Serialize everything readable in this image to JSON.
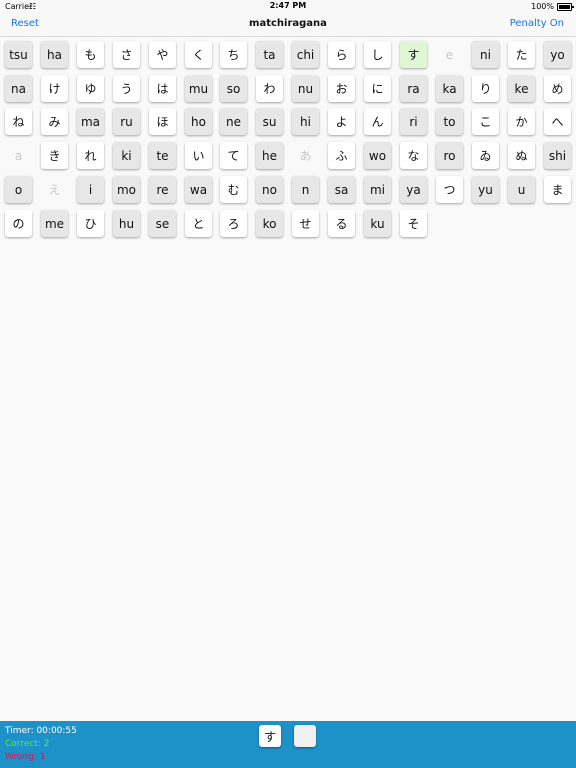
{
  "status_bar": {
    "carrier": "Carrier",
    "wifi": "wifi-icon",
    "time": "2:47 PM",
    "battery": "100%"
  },
  "nav": {
    "left": "Reset",
    "title": "matchiragana",
    "right": "Penalty On"
  },
  "grid": [
    [
      {
        "t": "tsu",
        "k": "romaji"
      },
      {
        "t": "ha",
        "k": "romaji"
      },
      {
        "t": "も",
        "k": "kana"
      },
      {
        "t": "さ",
        "k": "kana"
      },
      {
        "t": "や",
        "k": "kana"
      },
      {
        "t": "く",
        "k": "kana"
      },
      {
        "t": "ち",
        "k": "kana"
      },
      {
        "t": "ta",
        "k": "romaji"
      },
      {
        "t": "chi",
        "k": "romaji"
      },
      {
        "t": "ら",
        "k": "kana"
      },
      {
        "t": "し",
        "k": "kana"
      },
      {
        "t": "す",
        "k": "selected"
      },
      {
        "t": "e",
        "k": "matched"
      },
      {
        "t": "ni",
        "k": "romaji"
      },
      {
        "t": "た",
        "k": "kana"
      },
      {
        "t": "yo",
        "k": "romaji"
      }
    ],
    [
      {
        "t": "na",
        "k": "romaji"
      },
      {
        "t": "け",
        "k": "kana"
      },
      {
        "t": "ゆ",
        "k": "kana"
      },
      {
        "t": "う",
        "k": "kana"
      },
      {
        "t": "は",
        "k": "kana"
      },
      {
        "t": "mu",
        "k": "romaji"
      },
      {
        "t": "so",
        "k": "romaji"
      },
      {
        "t": "わ",
        "k": "kana"
      },
      {
        "t": "nu",
        "k": "romaji"
      },
      {
        "t": "お",
        "k": "kana"
      },
      {
        "t": "に",
        "k": "kana"
      },
      {
        "t": "ra",
        "k": "romaji"
      },
      {
        "t": "ka",
        "k": "romaji"
      },
      {
        "t": "り",
        "k": "kana"
      },
      {
        "t": "ke",
        "k": "romaji"
      },
      {
        "t": "め",
        "k": "kana"
      }
    ],
    [
      {
        "t": "ね",
        "k": "kana"
      },
      {
        "t": "み",
        "k": "kana"
      },
      {
        "t": "ma",
        "k": "romaji"
      },
      {
        "t": "ru",
        "k": "romaji"
      },
      {
        "t": "ほ",
        "k": "kana"
      },
      {
        "t": "ho",
        "k": "romaji"
      },
      {
        "t": "ne",
        "k": "romaji"
      },
      {
        "t": "su",
        "k": "romaji"
      },
      {
        "t": "hi",
        "k": "romaji"
      },
      {
        "t": "よ",
        "k": "kana"
      },
      {
        "t": "ん",
        "k": "kana"
      },
      {
        "t": "ri",
        "k": "romaji"
      },
      {
        "t": "to",
        "k": "romaji"
      },
      {
        "t": "こ",
        "k": "kana"
      },
      {
        "t": "か",
        "k": "kana"
      },
      {
        "t": "へ",
        "k": "kana"
      }
    ],
    [
      {
        "t": "a",
        "k": "matched"
      },
      {
        "t": "き",
        "k": "kana"
      },
      {
        "t": "れ",
        "k": "kana"
      },
      {
        "t": "ki",
        "k": "romaji"
      },
      {
        "t": "te",
        "k": "romaji"
      },
      {
        "t": "い",
        "k": "kana"
      },
      {
        "t": "て",
        "k": "kana"
      },
      {
        "t": "he",
        "k": "romaji"
      },
      {
        "t": "あ",
        "k": "matched"
      },
      {
        "t": "ふ",
        "k": "kana"
      },
      {
        "t": "wo",
        "k": "romaji"
      },
      {
        "t": "な",
        "k": "kana"
      },
      {
        "t": "ro",
        "k": "romaji"
      },
      {
        "t": "ゐ",
        "k": "kana"
      },
      {
        "t": "ぬ",
        "k": "kana"
      },
      {
        "t": "shi",
        "k": "romaji"
      }
    ],
    [
      {
        "t": "o",
        "k": "romaji"
      },
      {
        "t": "え",
        "k": "matched"
      },
      {
        "t": "i",
        "k": "romaji"
      },
      {
        "t": "mo",
        "k": "romaji"
      },
      {
        "t": "re",
        "k": "romaji"
      },
      {
        "t": "wa",
        "k": "romaji"
      },
      {
        "t": "む",
        "k": "kana"
      },
      {
        "t": "no",
        "k": "romaji"
      },
      {
        "t": "n",
        "k": "romaji"
      },
      {
        "t": "sa",
        "k": "romaji"
      },
      {
        "t": "mi",
        "k": "romaji"
      },
      {
        "t": "ya",
        "k": "romaji"
      },
      {
        "t": "つ",
        "k": "kana"
      },
      {
        "t": "yu",
        "k": "romaji"
      },
      {
        "t": "u",
        "k": "romaji"
      },
      {
        "t": "ま",
        "k": "kana"
      }
    ],
    [
      {
        "t": "の",
        "k": "kana"
      },
      {
        "t": "me",
        "k": "romaji"
      },
      {
        "t": "ひ",
        "k": "kana"
      },
      {
        "t": "hu",
        "k": "romaji"
      },
      {
        "t": "se",
        "k": "romaji"
      },
      {
        "t": "と",
        "k": "kana"
      },
      {
        "t": "ろ",
        "k": "kana"
      },
      {
        "t": "ko",
        "k": "romaji"
      },
      {
        "t": "せ",
        "k": "kana"
      },
      {
        "t": "る",
        "k": "kana"
      },
      {
        "t": "ku",
        "k": "romaji"
      },
      {
        "t": "そ",
        "k": "kana"
      }
    ]
  ],
  "footer": {
    "timer": "Timer: 00:00:55",
    "correct": "Correct: 2",
    "wrong": "Wrong: 1",
    "slot_a": "す",
    "slot_b": ""
  },
  "colors": {
    "accent": "#1576e8",
    "footer_bg": "#1d92c9",
    "correct": "#5bea39",
    "wrong": "#d4145a",
    "selected": "#dff7d4"
  }
}
